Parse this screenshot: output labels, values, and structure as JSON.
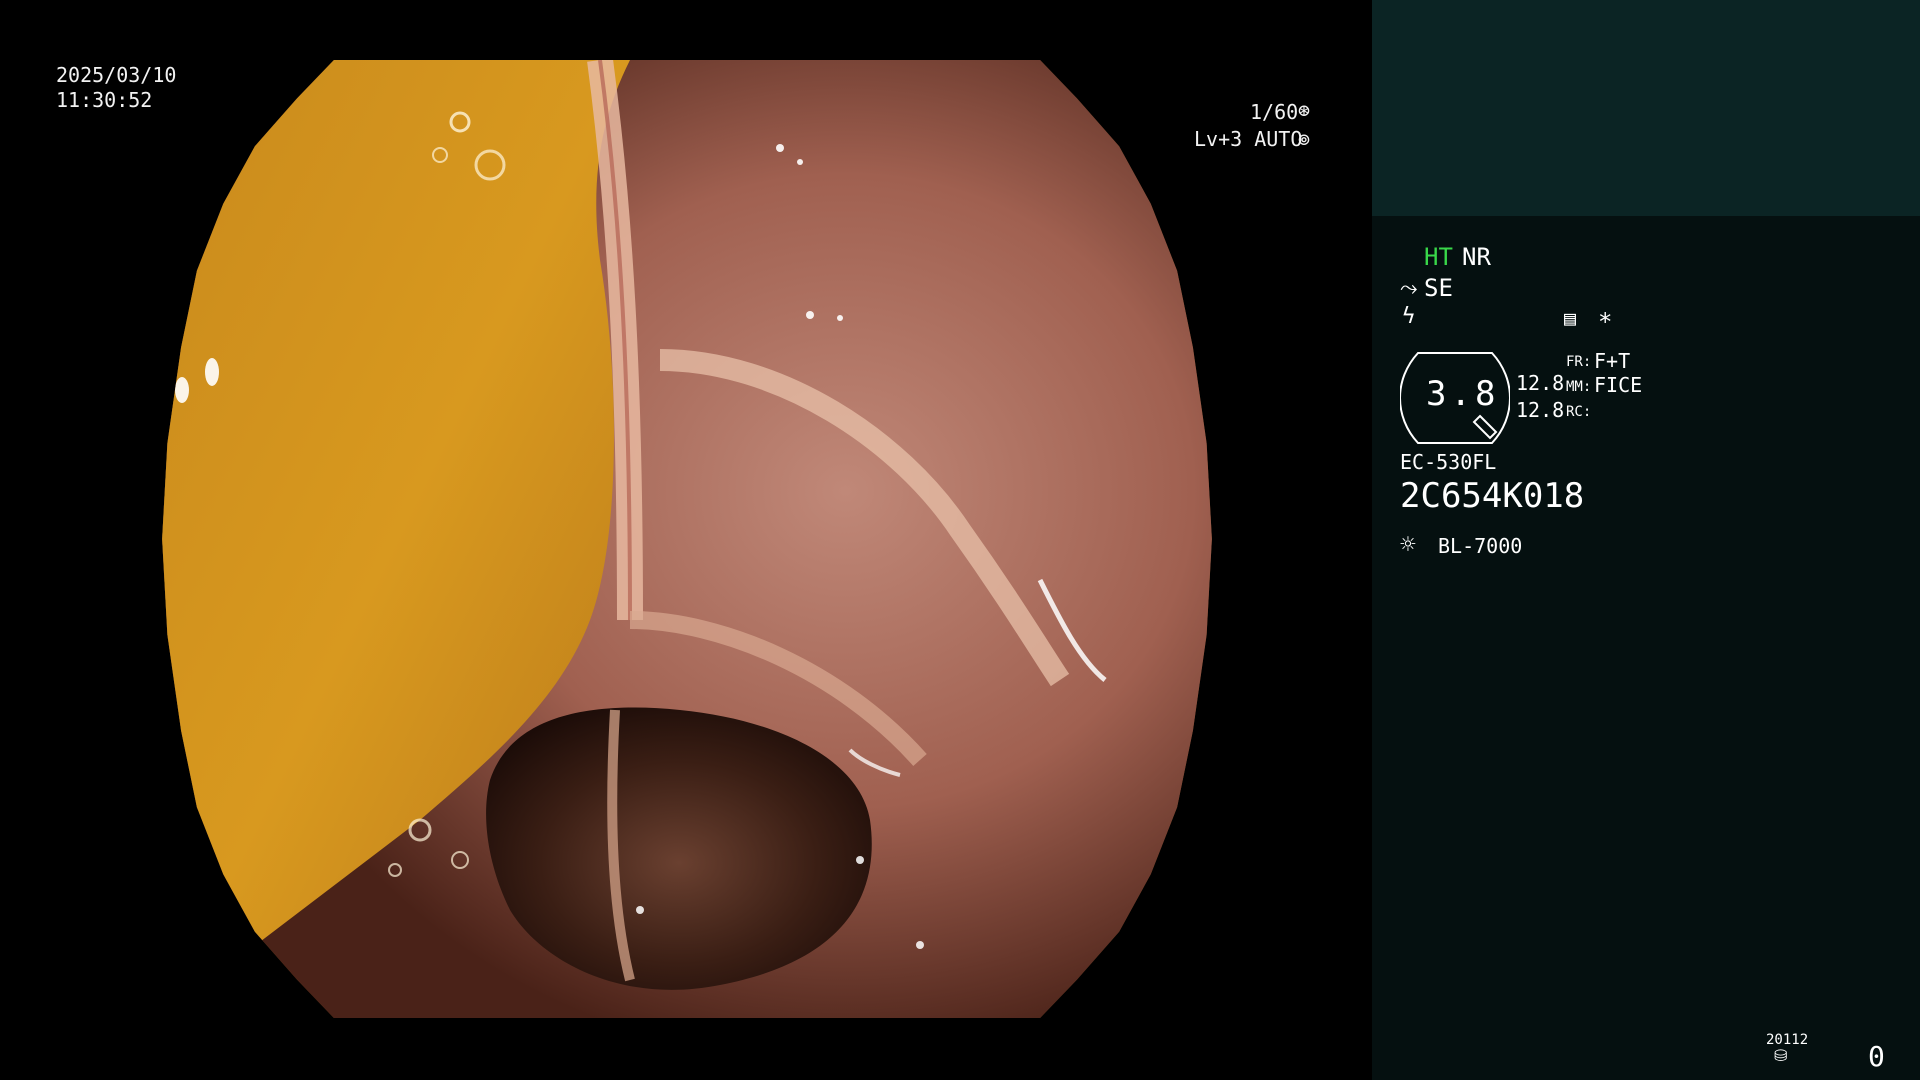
{
  "overlay": {
    "date": "2025/03/10",
    "time": "11:30:52",
    "shutter": "1/60",
    "enhance": "Lv+3 AUTO"
  },
  "panel": {
    "ht": "HT",
    "nr": "NR",
    "se": "SE",
    "asterisk": "*",
    "zoom_value": "3.8",
    "val1": "12.8",
    "val2": "12.8",
    "fr_label": "FR:",
    "fr_value": "F+T",
    "mm_label": "MM:",
    "mm_value": "FICE",
    "rc_label": "RC:",
    "scope_model": "EC-530FL",
    "scope_serial": "2C654K018",
    "light_source": "BL-7000",
    "counter_small": "20112",
    "counter_big": "0"
  },
  "colors": {
    "panel_bg": "#051010",
    "panel_top_bg": "#0b2424",
    "ht_green": "#39d84a",
    "fluid": "#d99a22",
    "mucosa": "#b07060"
  },
  "icons": {
    "shutter": "aperture-icon",
    "auto": "auto-icon",
    "se": "se-icon",
    "lightning": "lightning-icon",
    "memo": "memo-icon",
    "light_source": "sun-icon",
    "storage": "disk-icon"
  }
}
